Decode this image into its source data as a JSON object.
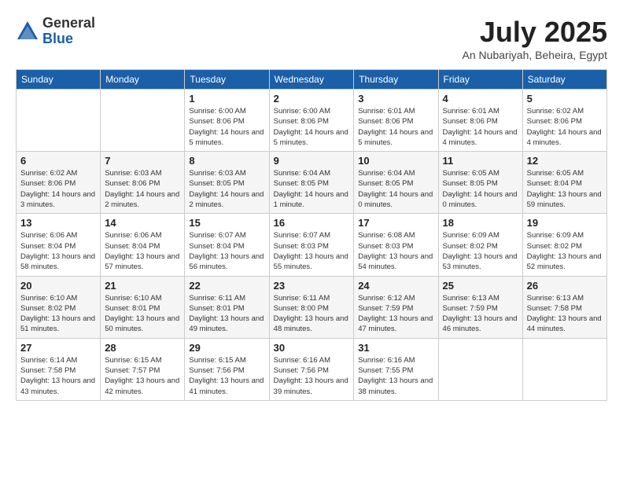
{
  "logo": {
    "general": "General",
    "blue": "Blue"
  },
  "title": "July 2025",
  "location": "An Nubariyah, Beheira, Egypt",
  "headers": [
    "Sunday",
    "Monday",
    "Tuesday",
    "Wednesday",
    "Thursday",
    "Friday",
    "Saturday"
  ],
  "weeks": [
    [
      {
        "day": "",
        "info": ""
      },
      {
        "day": "",
        "info": ""
      },
      {
        "day": "1",
        "info": "Sunrise: 6:00 AM\nSunset: 8:06 PM\nDaylight: 14 hours and 5 minutes."
      },
      {
        "day": "2",
        "info": "Sunrise: 6:00 AM\nSunset: 8:06 PM\nDaylight: 14 hours and 5 minutes."
      },
      {
        "day": "3",
        "info": "Sunrise: 6:01 AM\nSunset: 8:06 PM\nDaylight: 14 hours and 5 minutes."
      },
      {
        "day": "4",
        "info": "Sunrise: 6:01 AM\nSunset: 8:06 PM\nDaylight: 14 hours and 4 minutes."
      },
      {
        "day": "5",
        "info": "Sunrise: 6:02 AM\nSunset: 8:06 PM\nDaylight: 14 hours and 4 minutes."
      }
    ],
    [
      {
        "day": "6",
        "info": "Sunrise: 6:02 AM\nSunset: 8:06 PM\nDaylight: 14 hours and 3 minutes."
      },
      {
        "day": "7",
        "info": "Sunrise: 6:03 AM\nSunset: 8:06 PM\nDaylight: 14 hours and 2 minutes."
      },
      {
        "day": "8",
        "info": "Sunrise: 6:03 AM\nSunset: 8:05 PM\nDaylight: 14 hours and 2 minutes."
      },
      {
        "day": "9",
        "info": "Sunrise: 6:04 AM\nSunset: 8:05 PM\nDaylight: 14 hours and 1 minute."
      },
      {
        "day": "10",
        "info": "Sunrise: 6:04 AM\nSunset: 8:05 PM\nDaylight: 14 hours and 0 minutes."
      },
      {
        "day": "11",
        "info": "Sunrise: 6:05 AM\nSunset: 8:05 PM\nDaylight: 14 hours and 0 minutes."
      },
      {
        "day": "12",
        "info": "Sunrise: 6:05 AM\nSunset: 8:04 PM\nDaylight: 13 hours and 59 minutes."
      }
    ],
    [
      {
        "day": "13",
        "info": "Sunrise: 6:06 AM\nSunset: 8:04 PM\nDaylight: 13 hours and 58 minutes."
      },
      {
        "day": "14",
        "info": "Sunrise: 6:06 AM\nSunset: 8:04 PM\nDaylight: 13 hours and 57 minutes."
      },
      {
        "day": "15",
        "info": "Sunrise: 6:07 AM\nSunset: 8:04 PM\nDaylight: 13 hours and 56 minutes."
      },
      {
        "day": "16",
        "info": "Sunrise: 6:07 AM\nSunset: 8:03 PM\nDaylight: 13 hours and 55 minutes."
      },
      {
        "day": "17",
        "info": "Sunrise: 6:08 AM\nSunset: 8:03 PM\nDaylight: 13 hours and 54 minutes."
      },
      {
        "day": "18",
        "info": "Sunrise: 6:09 AM\nSunset: 8:02 PM\nDaylight: 13 hours and 53 minutes."
      },
      {
        "day": "19",
        "info": "Sunrise: 6:09 AM\nSunset: 8:02 PM\nDaylight: 13 hours and 52 minutes."
      }
    ],
    [
      {
        "day": "20",
        "info": "Sunrise: 6:10 AM\nSunset: 8:02 PM\nDaylight: 13 hours and 51 minutes."
      },
      {
        "day": "21",
        "info": "Sunrise: 6:10 AM\nSunset: 8:01 PM\nDaylight: 13 hours and 50 minutes."
      },
      {
        "day": "22",
        "info": "Sunrise: 6:11 AM\nSunset: 8:01 PM\nDaylight: 13 hours and 49 minutes."
      },
      {
        "day": "23",
        "info": "Sunrise: 6:11 AM\nSunset: 8:00 PM\nDaylight: 13 hours and 48 minutes."
      },
      {
        "day": "24",
        "info": "Sunrise: 6:12 AM\nSunset: 7:59 PM\nDaylight: 13 hours and 47 minutes."
      },
      {
        "day": "25",
        "info": "Sunrise: 6:13 AM\nSunset: 7:59 PM\nDaylight: 13 hours and 46 minutes."
      },
      {
        "day": "26",
        "info": "Sunrise: 6:13 AM\nSunset: 7:58 PM\nDaylight: 13 hours and 44 minutes."
      }
    ],
    [
      {
        "day": "27",
        "info": "Sunrise: 6:14 AM\nSunset: 7:58 PM\nDaylight: 13 hours and 43 minutes."
      },
      {
        "day": "28",
        "info": "Sunrise: 6:15 AM\nSunset: 7:57 PM\nDaylight: 13 hours and 42 minutes."
      },
      {
        "day": "29",
        "info": "Sunrise: 6:15 AM\nSunset: 7:56 PM\nDaylight: 13 hours and 41 minutes."
      },
      {
        "day": "30",
        "info": "Sunrise: 6:16 AM\nSunset: 7:56 PM\nDaylight: 13 hours and 39 minutes."
      },
      {
        "day": "31",
        "info": "Sunrise: 6:16 AM\nSunset: 7:55 PM\nDaylight: 13 hours and 38 minutes."
      },
      {
        "day": "",
        "info": ""
      },
      {
        "day": "",
        "info": ""
      }
    ]
  ]
}
